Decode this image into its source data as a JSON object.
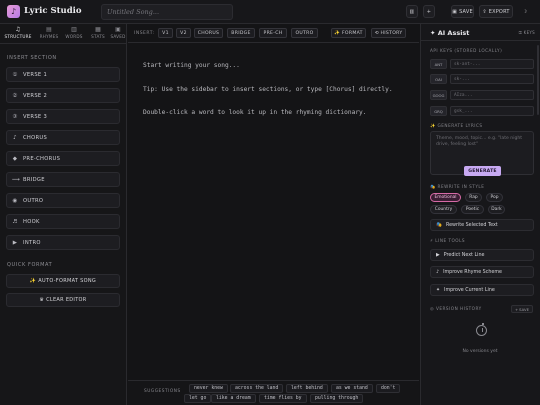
{
  "header": {
    "logo_glyph": "♪",
    "app_title": "Lyric Studio",
    "song_title_placeholder": "Untitled Song...",
    "layout_icon": "▥",
    "add_icon": "+",
    "save_label": "SAVE",
    "export_label": "EXPORT",
    "theme_icon": "☽"
  },
  "sidebar": {
    "tabs": [
      {
        "icon": "♫",
        "label": "STRUCTURE"
      },
      {
        "icon": "▤",
        "label": "RHYMES"
      },
      {
        "icon": "▥",
        "label": "WORDS"
      },
      {
        "icon": "▦",
        "label": "STATS"
      },
      {
        "icon": "▣",
        "label": "SAVED"
      }
    ],
    "insert_section_label": "INSERT SECTION",
    "sections": [
      {
        "icon": "①",
        "label": "VERSE 1"
      },
      {
        "icon": "②",
        "label": "VERSE 2"
      },
      {
        "icon": "③",
        "label": "VERSE 3"
      },
      {
        "icon": "♪",
        "label": "CHORUS"
      },
      {
        "icon": "◆",
        "label": "PRE-CHORUS"
      },
      {
        "icon": "⟿",
        "label": "BRIDGE"
      },
      {
        "icon": "◉",
        "label": "OUTRO"
      },
      {
        "icon": "♬",
        "label": "HOOK"
      },
      {
        "icon": "▶",
        "label": "INTRO"
      }
    ],
    "quick_format_label": "QUICK FORMAT",
    "auto_format_label": "✨ AUTO-FORMAT SONG",
    "clear_editor_label": "♛ CLEAR EDITOR"
  },
  "editor": {
    "insert_label": "INSERT:",
    "chips": [
      "V1",
      "V2",
      "CHORUS",
      "BRIDGE",
      "PRE-CH",
      "OUTRO"
    ],
    "format_label": "✨ FORMAT",
    "history_label": "⟲ HISTORY",
    "placeholder_lines": [
      "Start writing your song...",
      "Tip: Use the sidebar to insert sections, or type [Chorus] directly.",
      "Double-click a word to look it up in the rhyming dictionary."
    ],
    "suggestions_label": "SUGGESTIONS",
    "suggestions": [
      "never knew",
      "across the land",
      "left behind",
      "as we stand",
      "don't",
      "let go",
      "like a dream",
      "time flies by",
      "pulling through"
    ]
  },
  "assist": {
    "title": "AI Assist",
    "title_icon": "✦",
    "keys_link": "⚿ KEYS",
    "api_keys_label": "API KEYS (STORED LOCALLY)",
    "keys": [
      {
        "tag": "ANT",
        "value": "sk-ant-..."
      },
      {
        "tag": "OAI",
        "value": "sk-..."
      },
      {
        "tag": "GOOG",
        "value": "AIza..."
      },
      {
        "tag": "GRQ",
        "value": "gsk_..."
      }
    ],
    "generate_label": "✨ GENERATE LYRICS",
    "prompt_placeholder": "Theme, mood, topic... e.g. \"late night drive, feeling lost\"",
    "generate_button": "GENERATE",
    "rewrite_label": "🎭 REWRITE IN STYLE",
    "styles": [
      "Emotional",
      "Rap",
      "Pop",
      "Country",
      "Poetic",
      "Dark"
    ],
    "rewrite_button": "Rewrite Selected Text",
    "line_tools_label": "⚡ LINE TOOLS",
    "tools": [
      {
        "icon": "▶",
        "label": "Predict Next Line"
      },
      {
        "icon": "♪",
        "label": "Improve Rhyme Scheme"
      },
      {
        "icon": "✦",
        "label": "Improve Current Line"
      }
    ],
    "version_label": "◎ VERSION HISTORY",
    "version_save": "SAVE",
    "no_versions": "No versions yet"
  }
}
